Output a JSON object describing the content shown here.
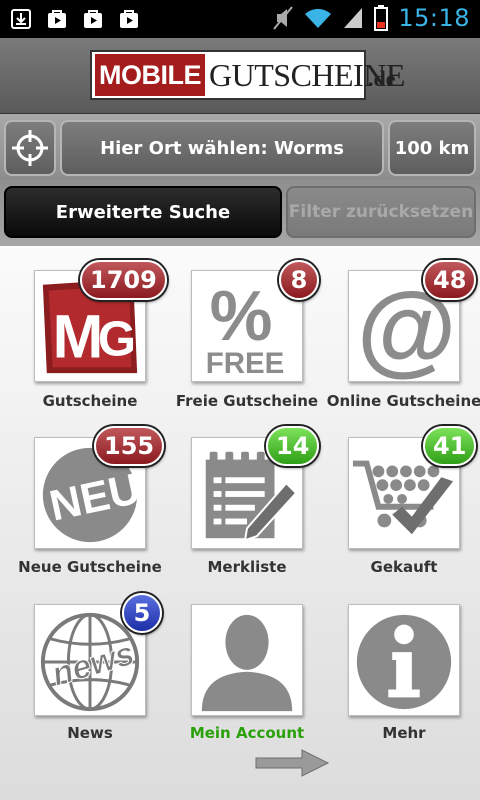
{
  "status_bar": {
    "time": "15:18",
    "notification_icons": [
      "download-icon",
      "play-store-icon",
      "play-store-icon",
      "shopping-bag-icon"
    ],
    "system_icons": [
      "mute-icon",
      "wifi-icon",
      "signal-icon",
      "battery-icon"
    ]
  },
  "header": {
    "logo_word1": "MOBILE",
    "logo_word2": "GUTSCHEINE",
    "logo_tld": ".de"
  },
  "location": {
    "locate_icon": "crosshair-icon",
    "city_label": "Hier Ort wählen: Worms",
    "radius_label": "100 km"
  },
  "search": {
    "advanced_label": "Erweiterte Suche",
    "reset_label": "Filter zurücksetzen"
  },
  "grid": {
    "items": [
      {
        "label": "Gutscheine",
        "icon": "mg-logo-icon",
        "badge": "1709",
        "badge_color": "#8b1a1f"
      },
      {
        "label": "Freie Gutscheine",
        "icon": "percent-free-icon",
        "badge": "8",
        "badge_color": "#8b1a1f"
      },
      {
        "label": "Online Gutscheine",
        "icon": "at-sign-icon",
        "badge": "48",
        "badge_color": "#8b1a1f"
      },
      {
        "label": "Neue Gutscheine",
        "icon": "neu-badge-icon",
        "badge": "155",
        "badge_color": "#8b1a1f"
      },
      {
        "label": "Merkliste",
        "icon": "notepad-pencil-icon",
        "badge": "14",
        "badge_color": "#2f9f17"
      },
      {
        "label": "Gekauft",
        "icon": "cart-check-icon",
        "badge": "41",
        "badge_color": "#2f9f17"
      },
      {
        "label": "News",
        "icon": "news-globe-icon",
        "badge": "5",
        "badge_color": "#1d2fa8"
      },
      {
        "label": "Mein Account",
        "icon": "user-silhouette-icon",
        "label_color": "#2aa00a"
      },
      {
        "label": "Mehr",
        "icon": "info-icon"
      }
    ]
  },
  "footer": {
    "next_icon": "arrow-right-icon"
  },
  "colors": {
    "brand_red": "#a51c1c",
    "status_time": "#3ab4e6",
    "account_green": "#2aa00a"
  }
}
